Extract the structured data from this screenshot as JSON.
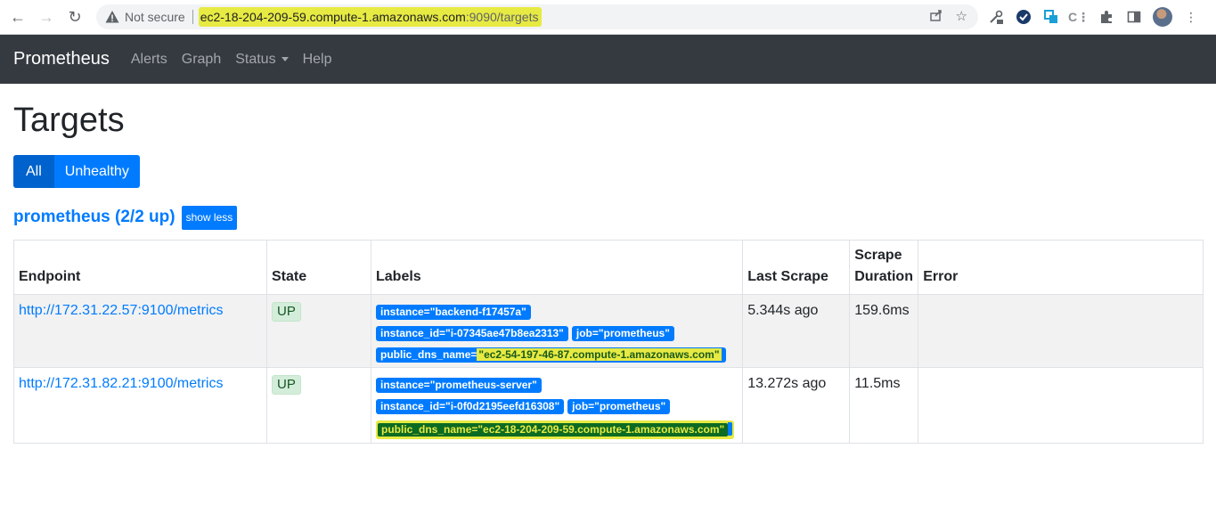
{
  "browser": {
    "not_secure_label": "Not secure",
    "url_host": "ec2-18-204-209-59.compute-1.amazonaws.com",
    "url_path": ":9090/targets"
  },
  "navbar": {
    "brand": "Prometheus",
    "links": [
      "Alerts",
      "Graph",
      "Status",
      "Help"
    ]
  },
  "page": {
    "title": "Targets",
    "filters": [
      "All",
      "Unhealthy"
    ],
    "pool_name": "prometheus (2/2 up)",
    "show_less_label": "show less"
  },
  "table": {
    "headers": {
      "endpoint": "Endpoint",
      "state": "State",
      "labels": "Labels",
      "last_scrape": "Last Scrape",
      "scrape_duration_1": "Scrape",
      "scrape_duration_2": "Duration",
      "error": "Error"
    },
    "rows": [
      {
        "endpoint": "http://172.31.22.57:9100/metrics",
        "state": "UP",
        "labels": {
          "instance": "instance=\"backend-f17457a\"",
          "instance_id": "instance_id=\"i-07345ae47b8ea2313\"",
          "job": "job=\"prometheus\"",
          "dns_key": "public_dns_name=",
          "dns_value": "\"ec2-54-197-46-87.compute-1.amazonaws.com\""
        },
        "last_scrape": "5.344s ago",
        "scrape_duration": "159.6ms",
        "error": ""
      },
      {
        "endpoint": "http://172.31.82.21:9100/metrics",
        "state": "UP",
        "labels": {
          "instance": "instance=\"prometheus-server\"",
          "instance_id": "instance_id=\"i-0f0d2195eefd16308\"",
          "job": "job=\"prometheus\"",
          "dns_full": "public_dns_name=\"ec2-18-204-209-59.compute-1.amazonaws.com\""
        },
        "last_scrape": "13.272s ago",
        "scrape_duration": "11.5ms",
        "error": ""
      }
    ]
  },
  "colors": {
    "prom_blue": "#007bff",
    "navbar_bg": "#343a40",
    "highlight_yellow": "#e7ea42",
    "up_badge_bg": "#d4edda"
  }
}
